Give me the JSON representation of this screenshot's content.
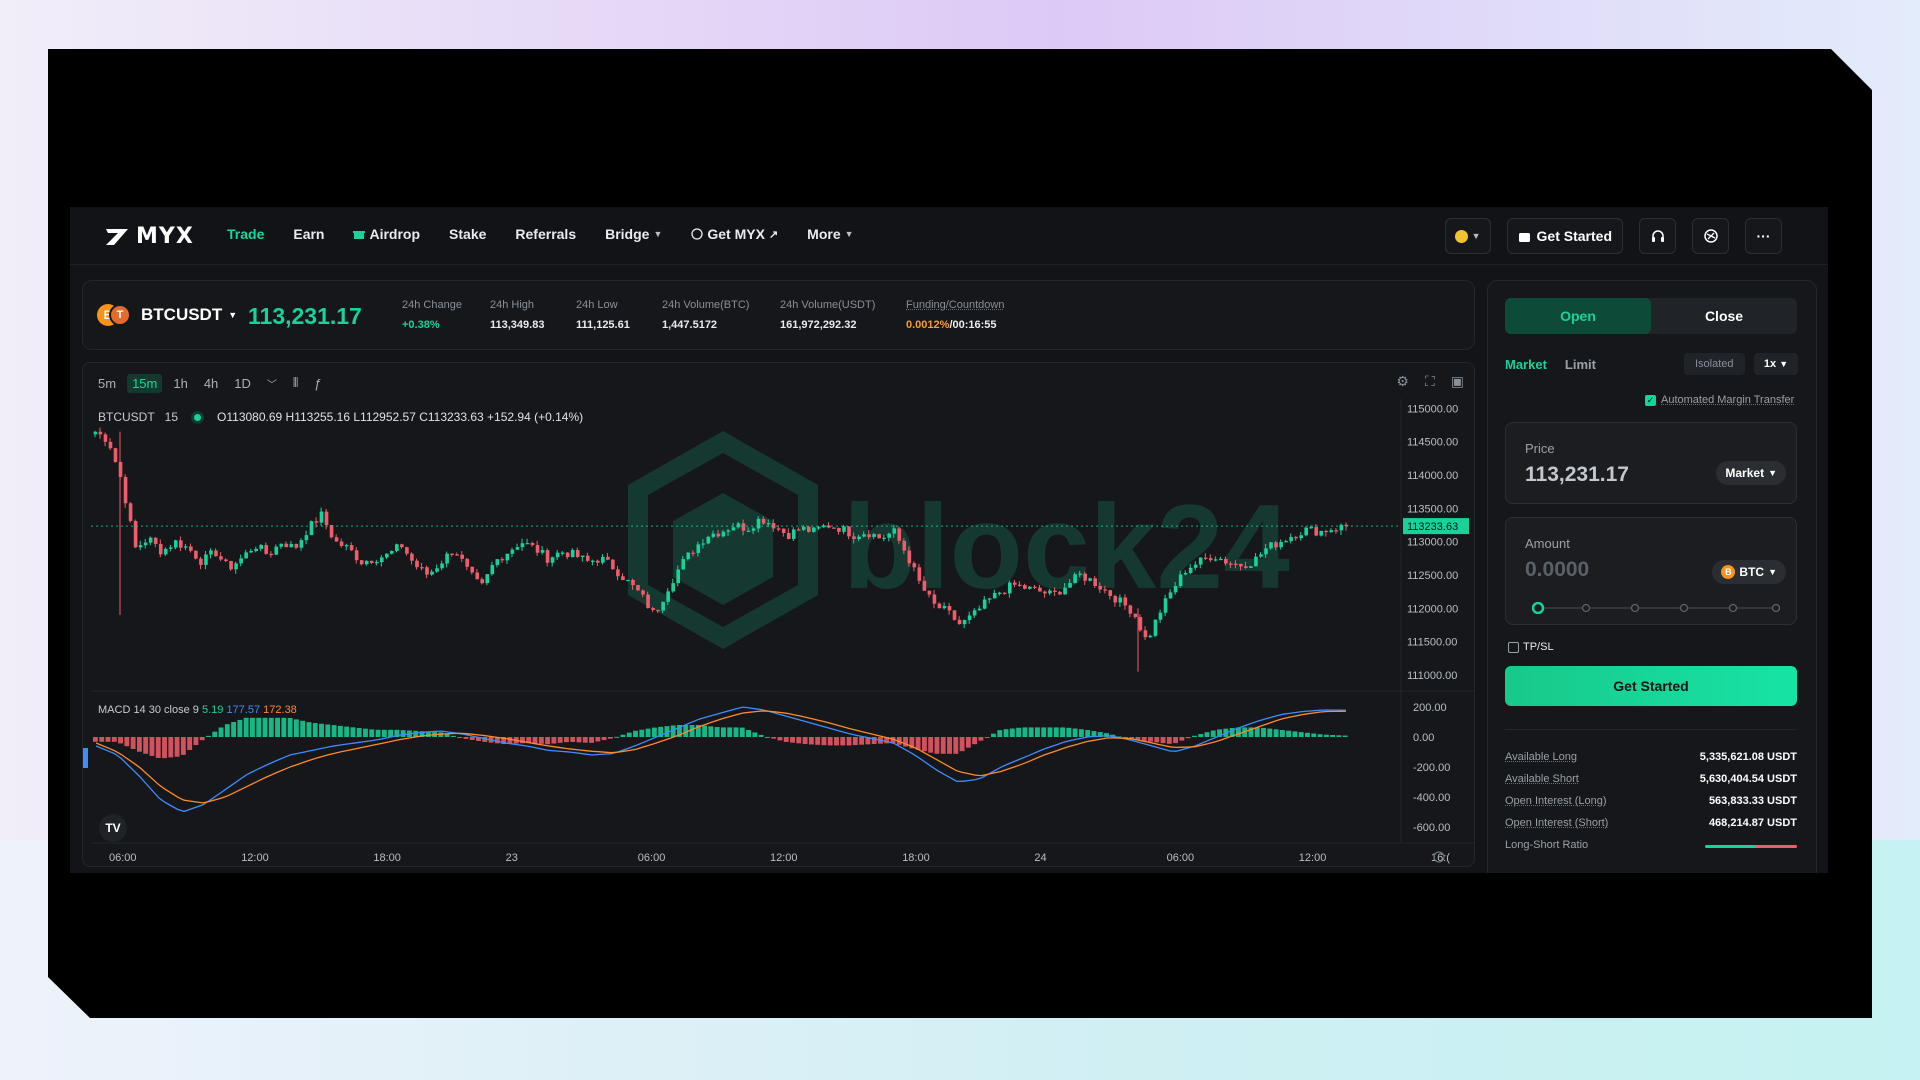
{
  "brand": {
    "name": "MYX"
  },
  "nav": {
    "items": [
      {
        "label": "Trade",
        "active": true
      },
      {
        "label": "Earn"
      },
      {
        "label": "Airdrop"
      },
      {
        "label": "Stake"
      },
      {
        "label": "Referrals"
      },
      {
        "label": "Bridge"
      },
      {
        "label": "Get MYX"
      },
      {
        "label": "More"
      }
    ],
    "get_started": "Get Started"
  },
  "ticker": {
    "pair": "BTCUSDT",
    "coin_a": "B",
    "coin_b": "T",
    "last_price": "113,231.17",
    "stats": [
      {
        "label": "24h Change",
        "value": "+0.38%"
      },
      {
        "label": "24h High",
        "value": "113,349.83"
      },
      {
        "label": "24h Low",
        "value": "111,125.61"
      },
      {
        "label": "24h Volume(BTC)",
        "value": "1,447.5172"
      },
      {
        "label": "24h Volume(USDT)",
        "value": "161,972,292.32"
      }
    ],
    "funding_label": "Funding/Countdown",
    "funding_rate": "0.0012%",
    "countdown": "/00:16:55"
  },
  "chart": {
    "timeframes": [
      "5m",
      "15m",
      "1h",
      "4h",
      "1D"
    ],
    "active_tf": "15m",
    "legend_symbol": "BTCUSDT",
    "legend_interval": "15",
    "ohlc": "O113080.69 H113255.16 L112952.57 C113233.63 +152.94 (+0.14%)",
    "macd": {
      "label": "MACD 14 30 close 9",
      "hist": "5.19",
      "macd": "177.57",
      "signal": "172.38"
    },
    "watermark": "block24",
    "tv_logo": "TV"
  },
  "chart_data": {
    "type": "candlestick",
    "price_axis": {
      "ticks": [
        "115000.00",
        "114500.00",
        "114000.00",
        "113500.00",
        "113000.00",
        "112500.00",
        "112000.00",
        "111500.00",
        "111000.00"
      ],
      "ylim": [
        110880,
        115050
      ]
    },
    "current_price_label": "113233.63",
    "macd_axis": {
      "ticks": [
        "200.00",
        "0.00",
        "-200.00",
        "-400.00",
        "-600.00"
      ],
      "ylim": [
        -640,
        260
      ]
    },
    "x_ticks": [
      "06:00",
      "12:00",
      "18:00",
      "23",
      "06:00",
      "12:00",
      "18:00",
      "24",
      "06:00",
      "12:00",
      "16:("
    ],
    "close_path": [
      114650,
      114520,
      113900,
      112900,
      113050,
      112850,
      113000,
      112900,
      112700,
      112850,
      112600,
      112750,
      112950,
      112800,
      113000,
      112900,
      113200,
      113400,
      113000,
      112900,
      112700,
      112750,
      112800,
      112950,
      112650,
      112500,
      112700,
      112900,
      112550,
      112300,
      112700,
      112850,
      113000,
      112900,
      112750,
      112850,
      112800,
      112700,
      112750,
      112600,
      112400,
      112200,
      111900,
      112300,
      112650,
      112900,
      113100,
      113150,
      113250,
      113200,
      113350,
      113250,
      113100,
      113200,
      113150,
      113250,
      113200,
      113100,
      113150,
      113050,
      113150,
      112800,
      112350,
      112050,
      111950,
      111750,
      111900,
      112100,
      112250,
      112350,
      112300,
      112250,
      112200,
      112350,
      112500,
      112400,
      112250,
      112100,
      111950,
      111500,
      111950,
      112300,
      112600,
      112700,
      112800,
      112700,
      112650,
      112700,
      112900,
      113000,
      113100,
      113180,
      113150,
      113200,
      113233
    ],
    "macd_path": [
      -60,
      -120,
      -260,
      -420,
      -500,
      -450,
      -350,
      -250,
      -180,
      -120,
      -90,
      -60,
      -40,
      -20,
      10,
      30,
      40,
      20,
      -10,
      -40,
      -60,
      -90,
      -100,
      -120,
      -110,
      -60,
      0,
      60,
      120,
      160,
      200,
      180,
      140,
      100,
      60,
      20,
      -10,
      -40,
      -120,
      -220,
      -300,
      -280,
      -200,
      -140,
      -80,
      -30,
      0,
      10,
      -20,
      -60,
      -100,
      -60,
      0,
      60,
      110,
      150,
      170,
      180,
      178
    ],
    "signal_path": [
      -40,
      -100,
      -200,
      -330,
      -420,
      -440,
      -400,
      -330,
      -260,
      -200,
      -150,
      -110,
      -80,
      -50,
      -20,
      5,
      20,
      25,
      10,
      -10,
      -35,
      -60,
      -80,
      -95,
      -105,
      -85,
      -40,
      10,
      70,
      120,
      160,
      175,
      160,
      130,
      95,
      55,
      20,
      -15,
      -70,
      -150,
      -230,
      -260,
      -230,
      -180,
      -120,
      -70,
      -30,
      -5,
      -10,
      -40,
      -70,
      -65,
      -30,
      20,
      70,
      120,
      150,
      170,
      172
    ]
  },
  "panel": {
    "open": "Open",
    "close": "Close",
    "market": "Market",
    "limit": "Limit",
    "isolated": "Isolated",
    "leverage": "1x",
    "amt_label": "Automated Margin Transfer",
    "price_label": "Price",
    "price_value": "113,231.17",
    "price_type": "Market",
    "amount_label": "Amount",
    "amount_value": "0.0000",
    "amount_coin": "BTC",
    "amount_coin_letter": "B",
    "tpsl": "TP/SL",
    "cta": "Get Started",
    "stats": [
      {
        "label": "Available Long",
        "value": "5,335,621.08 USDT"
      },
      {
        "label": "Available Short",
        "value": "5,630,404.54 USDT"
      },
      {
        "label": "Open Interest (Long)",
        "value": "563,833.33 USDT"
      },
      {
        "label": "Open Interest (Short)",
        "value": "468,214.87 USDT"
      }
    ],
    "ls_ratio": "Long-Short Ratio"
  },
  "colors": {
    "accent": "#17d39b",
    "down": "#f05d6a",
    "funding": "#ff9b2f"
  }
}
